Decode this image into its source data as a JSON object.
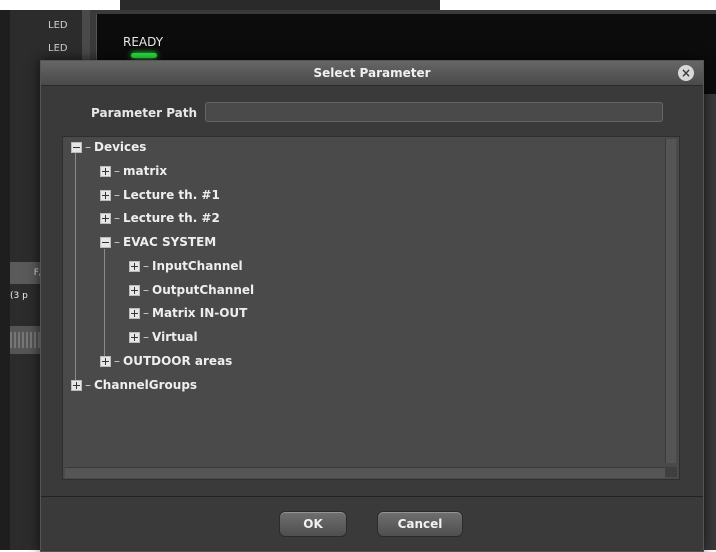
{
  "background": {
    "led_labels": [
      "LED",
      "LED"
    ],
    "status_text": "READY",
    "tab_label": "F/",
    "row_text": "(3 p",
    "led_color": "#2ee640"
  },
  "dialog": {
    "title": "Select Parameter",
    "parameter_path_label": "Parameter Path",
    "parameter_path_value": "",
    "tree": {
      "devices": "Devices",
      "matrix": "matrix",
      "lecture1": "Lecture th. #1",
      "lecture2": "Lecture th. #2",
      "evac": "EVAC SYSTEM",
      "input_channel": "InputChannel",
      "output_channel": "OutputChannel",
      "matrix_in_out": "Matrix IN-OUT",
      "virtual": "Virtual",
      "outdoor": "OUTDOOR areas",
      "channel_groups": "ChannelGroups"
    },
    "ok_label": "OK",
    "cancel_label": "Cancel",
    "close_icon": "close-icon"
  }
}
